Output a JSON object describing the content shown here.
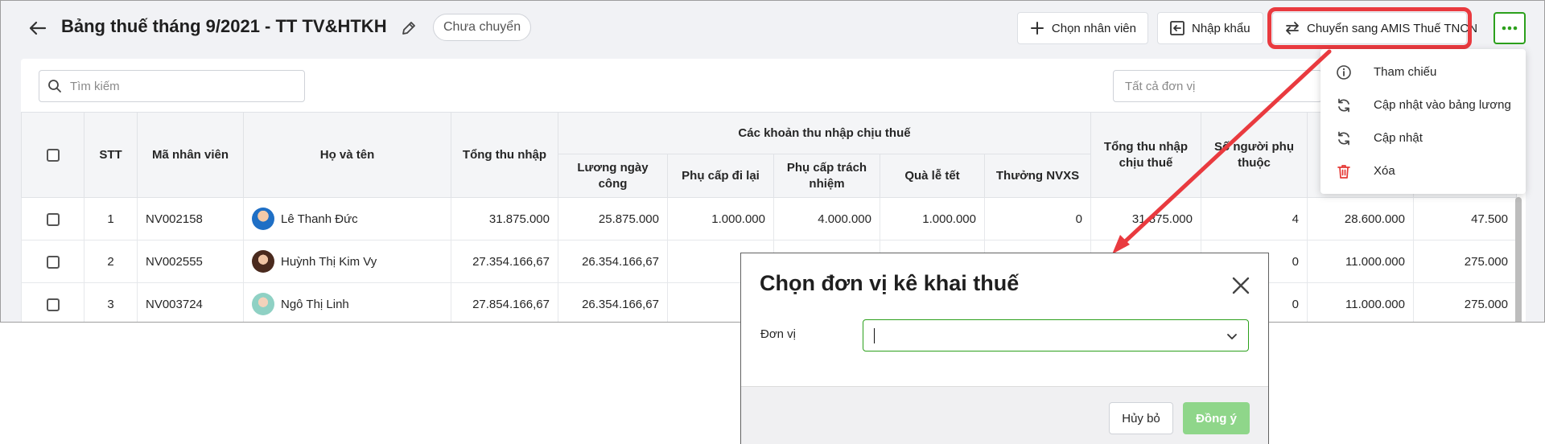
{
  "header": {
    "title": "Bảng thuế tháng 9/2021 - TT TV&HTKH",
    "status": "Chưa chuyển",
    "add_employee": "Chọn nhân viên",
    "import": "Nhập khẩu",
    "transfer": "Chuyển sang AMIS Thuế TNCN"
  },
  "toolbar": {
    "search_placeholder": "Tìm kiếm",
    "unit_placeholder": "Tất cả đơn vị"
  },
  "table": {
    "headers": {
      "stt": "STT",
      "code": "Mã nhân viên",
      "name": "Họ và tên",
      "total_income": "Tổng thu nhập",
      "taxable_group": "Các khoản thu nhập chịu thuế",
      "salary": "Lương ngày công",
      "travel": "Phụ cấp đi lại",
      "responsibility": "Phụ cấp trách nhiệm",
      "gift": "Quà lễ tết",
      "bonus": "Thưởng NVXS",
      "taxable_total": "Tổng thu nhập chịu thuế",
      "dependents": "Số người phụ thuộc"
    },
    "rows": [
      {
        "stt": "1",
        "code": "NV002158",
        "name": "Lê Thanh Đức",
        "total": "31.875.000",
        "salary": "25.875.000",
        "travel": "1.000.000",
        "resp": "4.000.000",
        "gift": "1.000.000",
        "bonus": "0",
        "taxable": "31.875.000",
        "dependents": "4",
        "col12": "28.600.000",
        "col13": "47.500"
      },
      {
        "stt": "2",
        "code": "NV002555",
        "name": "Huỳnh Thị Kim Vy",
        "total": "27.354.166,67",
        "salary": "26.354.166,67",
        "travel": "",
        "resp": "",
        "gift": "",
        "bonus": "",
        "taxable": "",
        "dependents": "0",
        "col12": "11.000.000",
        "col13": "275.000"
      },
      {
        "stt": "3",
        "code": "NV003724",
        "name": "Ngô Thị Linh",
        "total": "27.854.166,67",
        "salary": "26.354.166,67",
        "travel": "",
        "resp": "",
        "gift": "",
        "bonus": "",
        "taxable": "",
        "dependents": "0",
        "col12": "11.000.000",
        "col13": "275.000"
      }
    ]
  },
  "menu": {
    "items": [
      {
        "label": "Tham chiếu",
        "icon": "info-icon"
      },
      {
        "label": "Cập nhật vào bảng lương",
        "icon": "refresh-icon"
      },
      {
        "label": "Cập nhật",
        "icon": "refresh-icon"
      },
      {
        "label": "Xóa",
        "icon": "trash-icon"
      }
    ]
  },
  "dialog": {
    "title": "Chọn đơn vị kê khai thuế",
    "field_label": "Đơn vị",
    "field_value": "",
    "cancel": "Hủy bỏ",
    "ok": "Đồng ý"
  },
  "colors": {
    "accent_green": "#2ca01c",
    "highlight_red": "#e93a3f",
    "delete_red": "#e53935"
  }
}
